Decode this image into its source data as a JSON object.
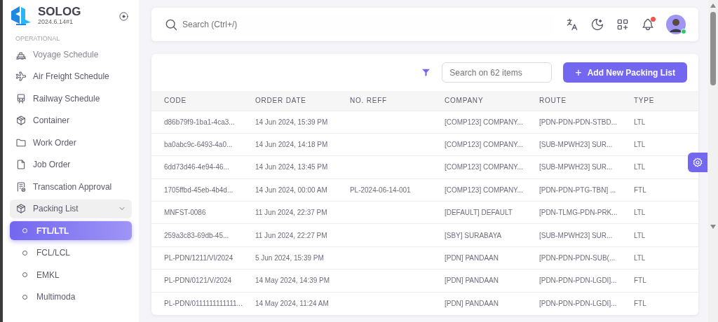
{
  "brand": {
    "name": "SOLOG",
    "version": "2024.6.14#1"
  },
  "sidebar": {
    "section": "OPERATIONAL",
    "items": [
      {
        "label": "Voyage Schedule",
        "selected": false
      },
      {
        "label": "Air Freight Schedule",
        "selected": false
      },
      {
        "label": "Railway Schedule",
        "selected": false
      },
      {
        "label": "Container",
        "selected": false
      },
      {
        "label": "Work Order",
        "selected": false
      },
      {
        "label": "Job Order",
        "selected": false
      },
      {
        "label": "Transcation Approval",
        "selected": false
      },
      {
        "label": "Packing List",
        "selected": false,
        "expanded": true,
        "children": [
          {
            "label": "FTL/LTL",
            "selected": true
          },
          {
            "label": "FCL/LCL",
            "selected": false
          },
          {
            "label": "EMKL",
            "selected": false
          },
          {
            "label": "Multimoda",
            "selected": false
          }
        ]
      }
    ]
  },
  "topbar": {
    "search_placeholder": "Search (Ctrl+/)",
    "notification_unread": true,
    "online": true
  },
  "toolbar": {
    "search_placeholder": "Search on 62 items",
    "add_button": "Add New Packing List",
    "add_icon": "+"
  },
  "table": {
    "columns": [
      "CODE",
      "ORDER DATE",
      "NO. REFF",
      "COMPANY",
      "ROUTE",
      "TYPE"
    ],
    "rows": [
      [
        "d86b79f9-1ba1-4ca3...",
        "14 Jun 2024, 15:39 PM",
        "",
        "[COMP123] COMPANY...",
        "[PDN-PDN-PDN-STBD...",
        "LTL"
      ],
      [
        "ba0abc9c-6493-4a0...",
        "14 Jun 2024, 14:18 PM",
        "",
        "[COMP123] COMPANY...",
        "[SUB-MPWH23] SUR...",
        "LTL"
      ],
      [
        "6dd73d46-4e94-46...",
        "14 Jun 2024, 13:45 PM",
        "",
        "[COMP123] COMPANY...",
        "[SUB-MPWH23] SUR...",
        "LTL"
      ],
      [
        "1705ffbd-45eb-4b4d...",
        "14 Jun 2024, 00:00 AM",
        "PL-2024-06-14-001",
        "[COMP123] COMPANY...",
        "[PDN-PDN-PTG-TBN] ...",
        "FTL"
      ],
      [
        "MNFST-0086",
        "11 Jun 2024, 22:37 PM",
        "",
        "[DEFAULT] DEFAULT",
        "[PDN-TLMG-PDN-PRK...",
        "LTL"
      ],
      [
        "259a3c83-69db-45...",
        "11 Jun 2024, 22:27 PM",
        "",
        "[SBY] SURABAYA",
        "[SUB-MPWH23] SUR...",
        "LTL"
      ],
      [
        "PL-PDN/1211/VI/2024",
        "5 Jun 2024, 15:39 PM",
        "",
        "[PDN] PANDAAN",
        "[PDN-PDN-PDN-SUB(...",
        "LTL"
      ],
      [
        "PL-PDN/0121/V/2024",
        "14 May 2024, 14:39 PM",
        "",
        "[PDN] PANDAAN",
        "[PDN-PDN-PDN-LGDI]...",
        "FTL"
      ],
      [
        "PL-PDN/0111111111111...",
        "14 May 2024, 11:24 AM",
        "",
        "[PDN] PANDAAN",
        "[PDN-PDN-PDN-LGDI]...",
        "FTL"
      ]
    ]
  }
}
